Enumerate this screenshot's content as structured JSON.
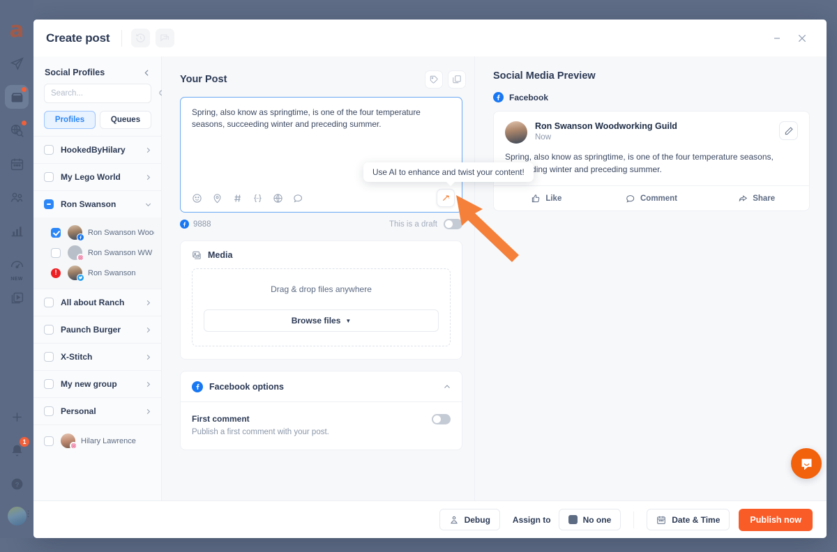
{
  "rail": {
    "logo": "a",
    "items": [
      {
        "name": "send-icon",
        "label": "Publisher",
        "active": false,
        "dot": false
      },
      {
        "name": "inbox-icon",
        "label": "Inbox",
        "active": true,
        "dot": true
      },
      {
        "name": "globe-search-icon",
        "label": "Discovery",
        "active": false,
        "dot": true
      },
      {
        "name": "calendar-icon",
        "label": "Calendar",
        "active": false,
        "dot": false
      },
      {
        "name": "users-icon",
        "label": "Audience",
        "active": false,
        "dot": false
      },
      {
        "name": "analytics-icon",
        "label": "Analytics",
        "active": false,
        "dot": false
      },
      {
        "name": "speedometer-icon",
        "label": "Dashboard",
        "active": false,
        "dot": false,
        "tag": "NEW"
      },
      {
        "name": "video-icon",
        "label": "Video",
        "active": false,
        "dot": false
      }
    ],
    "bottom": [
      {
        "name": "plus-icon",
        "label": "Add"
      },
      {
        "name": "bell-icon",
        "label": "Notifications",
        "badge": "1"
      },
      {
        "name": "help-icon",
        "label": "Help"
      }
    ]
  },
  "header": {
    "title": "Create post",
    "history_label": "History",
    "comments_label": "Comments",
    "minimize_label": "Minimize",
    "close_label": "Close"
  },
  "sidebar": {
    "title": "Social Profiles",
    "collapse_label": "Collapse",
    "search": {
      "value": "",
      "placeholder": "Search..."
    },
    "tabs": [
      {
        "label": "Profiles",
        "active": true
      },
      {
        "label": "Queues",
        "active": false
      }
    ],
    "groups": [
      {
        "label": "HookedByHilary",
        "state": "unchecked",
        "expanded": false
      },
      {
        "label": "My Lego World",
        "state": "unchecked",
        "expanded": false
      },
      {
        "label": "Ron Swanson",
        "state": "indeterminate",
        "expanded": true,
        "children": [
          {
            "label": "Ron Swanson Woodwo...",
            "state": "checked",
            "network": "facebook",
            "avatar": "photo"
          },
          {
            "label": "Ron Swanson WW Guild",
            "state": "unchecked",
            "network": "instagram",
            "avatar": "gray"
          },
          {
            "label": "Ron Swanson",
            "state": "error",
            "network": "twitter",
            "avatar": "photo"
          }
        ]
      },
      {
        "label": "All about Ranch",
        "state": "unchecked",
        "expanded": false
      },
      {
        "label": "Paunch Burger",
        "state": "unchecked",
        "expanded": false
      },
      {
        "label": "X-Stitch",
        "state": "unchecked",
        "expanded": false
      },
      {
        "label": "My new group",
        "state": "unchecked",
        "expanded": false
      },
      {
        "label": "Personal",
        "state": "unchecked",
        "expanded": false
      }
    ],
    "standalone": {
      "label": "Hilary Lawrence",
      "state": "unchecked",
      "network": "instagram"
    }
  },
  "editor": {
    "title": "Your Post",
    "tag_label": "Tags",
    "duplicate_label": "Duplicate",
    "content": "Spring, also know as springtime, is one of the four temperature seasons, succeeding winter and preceding summer.",
    "tools": [
      {
        "name": "emoji-icon",
        "label": "Emoji"
      },
      {
        "name": "location-icon",
        "label": "Location"
      },
      {
        "name": "hashtag-icon",
        "label": "Hashtag"
      },
      {
        "name": "variable-icon",
        "label": "Variable"
      },
      {
        "name": "globe-icon",
        "label": "Link"
      },
      {
        "name": "speech-bubble-icon",
        "label": "Reply"
      }
    ],
    "ai_button_label": "AI assist",
    "char_count": "9888",
    "draft_label": "This is a draft",
    "draft_on": false
  },
  "tooltip": {
    "text": "Use AI to enhance and twist your content!"
  },
  "media": {
    "title": "Media",
    "dropzone_text": "Drag & drop files anywhere",
    "browse_label": "Browse files",
    "browse_caret": "▼"
  },
  "facebook_options": {
    "title": "Facebook options",
    "collapse_label": "Collapse section",
    "first_comment": {
      "title": "First comment",
      "subtitle": "Publish a first comment with your post.",
      "enabled": false
    }
  },
  "preview": {
    "title": "Social Media Preview",
    "network_label": "Facebook",
    "post": {
      "author": "Ron Swanson Woodworking Guild",
      "time": "Now",
      "text": "Spring, also know as springtime, is one of the four temperature seasons, succeeding winter and preceding summer.",
      "edit_label": "Edit"
    },
    "actions": [
      {
        "label": "Like",
        "icon": "thumbs-up-icon"
      },
      {
        "label": "Comment",
        "icon": "comment-icon"
      },
      {
        "label": "Share",
        "icon": "share-icon"
      }
    ]
  },
  "footer": {
    "debug_label": "Debug",
    "assign_label": "Assign to",
    "assignee_label": "No one",
    "date_label": "Date & Time",
    "publish_label": "Publish now"
  },
  "chat": {
    "label": "Support chat"
  },
  "colors": {
    "accent_orange": "#fa5c28",
    "brand_blue": "#2b86f7",
    "facebook_blue": "#1877f2",
    "error_red": "#ed2024",
    "arrow_orange": "#f4803a"
  }
}
